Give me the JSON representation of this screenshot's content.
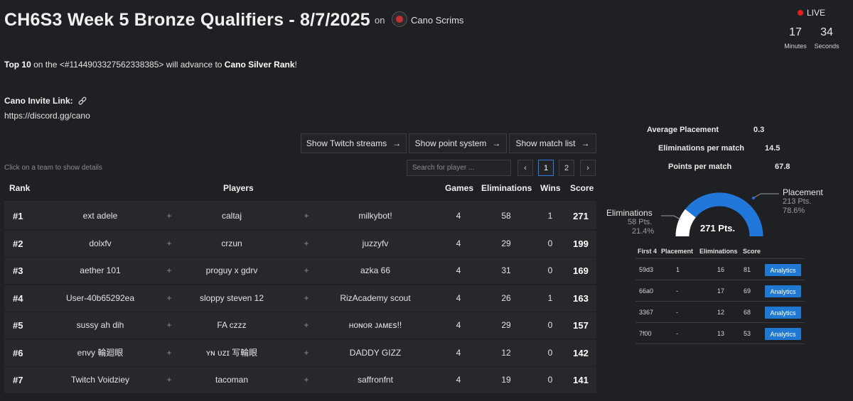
{
  "header": {
    "title": "CH6S3 Week 5 Bronze Qualifiers - 8/7/2025",
    "on": "on",
    "org_name": "Cano Scrims"
  },
  "live": {
    "label": "LIVE",
    "minutes_value": "17",
    "minutes_label": "Minutes",
    "seconds_value": "34",
    "seconds_label": "Seconds"
  },
  "intro": {
    "bold_start": "Top 10",
    "middle": " on the <#1144903327562338385> will advance to ",
    "bold_end": "Cano Silver Rank",
    "end": "!"
  },
  "invite": {
    "label": "Cano Invite Link:",
    "url": "https://discord.gg/cano"
  },
  "buttons": {
    "twitch": "Show Twitch streams",
    "points": "Show point system",
    "matches": "Show match list"
  },
  "hint": "Click on a team to show details",
  "search": {
    "placeholder": "Search for player ..."
  },
  "pagination": {
    "prev": "‹",
    "page1": "1",
    "page2": "2",
    "next": "›"
  },
  "table": {
    "headers": {
      "rank": "Rank",
      "players": "Players",
      "games": "Games",
      "elims": "Eliminations",
      "wins": "Wins",
      "score": "Score"
    },
    "plus": "+",
    "rows": [
      {
        "rank": "#1",
        "p1": "ext adele",
        "p2": "caltaj",
        "p3": "milkybot!",
        "games": "4",
        "elims": "58",
        "wins": "1",
        "score": "271"
      },
      {
        "rank": "#2",
        "p1": "dolxfv",
        "p2": "crzun",
        "p3": "juzzyfv",
        "games": "4",
        "elims": "29",
        "wins": "0",
        "score": "199"
      },
      {
        "rank": "#3",
        "p1": "aether 101",
        "p2": "proguy x gdrv",
        "p3": "azka 66",
        "games": "4",
        "elims": "31",
        "wins": "0",
        "score": "169"
      },
      {
        "rank": "#4",
        "p1": "User-40b65292ea",
        "p2": "sloppy steven 12",
        "p3": "RizAcademy scout",
        "games": "4",
        "elims": "26",
        "wins": "1",
        "score": "163"
      },
      {
        "rank": "#5",
        "p1": "sussy ah dih",
        "p2": "FA czzz",
        "p3": "ʜᴏɴᴏʀ ᴊᴀᴍᴇꜱ!!",
        "games": "4",
        "elims": "29",
        "wins": "0",
        "score": "157"
      },
      {
        "rank": "#6",
        "p1": "envy 輪廻眼",
        "p2": "ʏɴ ᴜᴢɪ 写輪眼",
        "p3": "DADDY GIZZ",
        "games": "4",
        "elims": "12",
        "wins": "0",
        "score": "142"
      },
      {
        "rank": "#7",
        "p1": "Twitch Voidziey",
        "p2": "tacoman",
        "p3": "saffronfnt",
        "games": "4",
        "elims": "19",
        "wins": "0",
        "score": "141"
      }
    ]
  },
  "stats": {
    "avg_placement_label": "Average Placement",
    "avg_placement_value": "0.3",
    "elims_label": "Eliminations per match",
    "elims_value": "14.5",
    "points_label": "Points per match",
    "points_value": "67.8"
  },
  "gauge": {
    "center": "271 Pts.",
    "placement_title": "Placement",
    "placement_pts": "213 Pts.",
    "placement_pct": "78.6%",
    "placement_fraction": 0.786,
    "elims_title": "Eliminations",
    "elims_pts": "58 Pts.",
    "elims_pct": "21.4%",
    "elims_fraction": 0.214,
    "colors": {
      "placement": "#2176d9",
      "elims": "#ffffff"
    }
  },
  "matches": {
    "headers": {
      "id": "First 4",
      "placement": "Placement",
      "elims": "Eliminations",
      "score": "Score"
    },
    "rows": [
      {
        "id": "59d3",
        "placement": "1",
        "elims": "16",
        "score": "81",
        "button": "Analytics"
      },
      {
        "id": "66a0",
        "placement": "-",
        "elims": "17",
        "score": "69",
        "button": "Analytics"
      },
      {
        "id": "3367",
        "placement": "-",
        "elims": "12",
        "score": "68",
        "button": "Analytics"
      },
      {
        "id": "7f00",
        "placement": "-",
        "elims": "13",
        "score": "53",
        "button": "Analytics"
      }
    ]
  },
  "accent_color": "#1f78d1",
  "live_color": "#e0211d"
}
